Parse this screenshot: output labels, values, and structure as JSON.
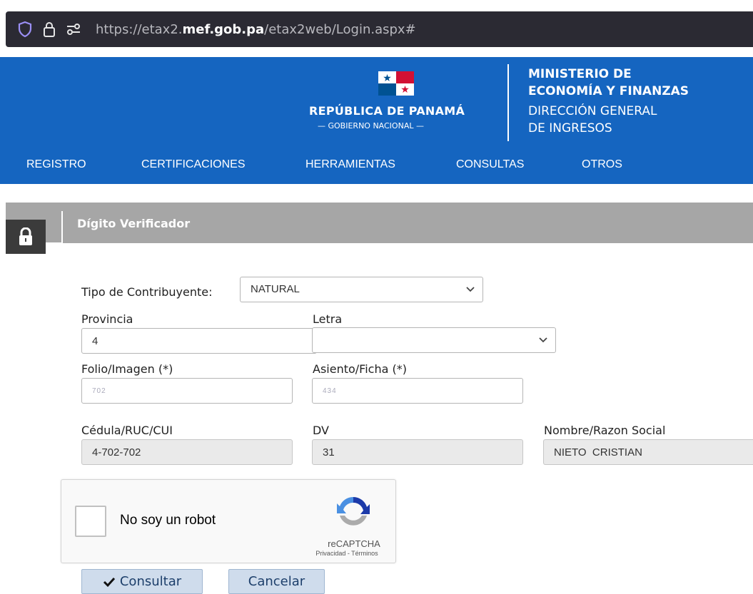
{
  "browser": {
    "url_prefix": "https://etax2.",
    "url_domain": "mef.gob.pa",
    "url_suffix": "/etax2web/Login.aspx#"
  },
  "header": {
    "republic_title": "REPÚBLICA DE PANAMÁ",
    "republic_subtitle": "— GOBIERNO NACIONAL —",
    "ministry_line1": "MINISTERIO DE",
    "ministry_line2": "ECONOMÍA Y FINANZAS",
    "direction_line1": "DIRECCIÓN GENERAL",
    "direction_line2": "DE INGRESOS",
    "brand_color": "#1565c0"
  },
  "nav": {
    "items": [
      {
        "label": "REGISTRO"
      },
      {
        "label": "CERTIFICACIONES"
      },
      {
        "label": "HERRAMIENTAS"
      },
      {
        "label": "CONSULTAS"
      },
      {
        "label": "OTROS"
      }
    ]
  },
  "section": {
    "title": "Dígito Verificador",
    "icon": "lock-icon"
  },
  "form": {
    "tipo_label": "Tipo de Contribuyente:",
    "tipo_value": "NATURAL",
    "provincia_label": "Provincia",
    "provincia_value": "4",
    "letra_label": "Letra",
    "letra_value": "",
    "folio_label": "Folio/Imagen (*)",
    "folio_value": "702",
    "asiento_label": "Asiento/Ficha (*)",
    "asiento_value": "434",
    "cedula_label": "Cédula/RUC/CUI",
    "cedula_value": "4-702-702",
    "dv_label": "DV",
    "dv_value": "31",
    "nombre_label": "Nombre/Razon Social",
    "nombre_value": "NIETO  CRISTIAN"
  },
  "captcha": {
    "label": "No soy un robot",
    "brand": "reCAPTCHA",
    "links": "Privacidad - Términos"
  },
  "buttons": {
    "consultar": "Consultar",
    "cancelar": "Cancelar"
  }
}
